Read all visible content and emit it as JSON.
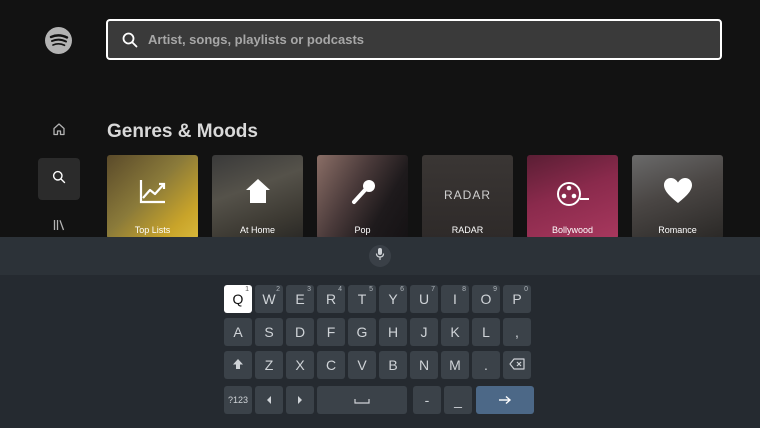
{
  "header": {
    "logo_icon": "spotify-logo",
    "search_placeholder": "Artist, songs, playlists or podcasts"
  },
  "sidebar": {
    "items": [
      {
        "icon": "home-icon"
      },
      {
        "icon": "search-icon",
        "selected": true
      },
      {
        "icon": "library-icon"
      }
    ]
  },
  "section": {
    "title": "Genres & Moods",
    "tiles": [
      {
        "label": "Top Lists",
        "icon": "trending-up-icon"
      },
      {
        "label": "At Home",
        "icon": "house-icon"
      },
      {
        "label": "Pop",
        "icon": "microphone-icon"
      },
      {
        "label": "RADAR",
        "title_text": "RADAR"
      },
      {
        "label": "Bollywood",
        "icon": "film-reel-icon"
      },
      {
        "label": "Romance",
        "icon": "heart-icon"
      }
    ]
  },
  "keyboard": {
    "mic_icon": "microphone-icon",
    "row1": [
      {
        "k": "Q",
        "sup": "1"
      },
      {
        "k": "W",
        "sup": "2"
      },
      {
        "k": "E",
        "sup": "3"
      },
      {
        "k": "R",
        "sup": "4"
      },
      {
        "k": "T",
        "sup": "5"
      },
      {
        "k": "Y",
        "sup": "6"
      },
      {
        "k": "U",
        "sup": "7"
      },
      {
        "k": "I",
        "sup": "8"
      },
      {
        "k": "O",
        "sup": "9"
      },
      {
        "k": "P",
        "sup": "0"
      }
    ],
    "row2": [
      "A",
      "S",
      "D",
      "F",
      "G",
      "H",
      "J",
      "K",
      "L",
      ","
    ],
    "row3": [
      "Z",
      "X",
      "C",
      "V",
      "B",
      "N",
      "M",
      "."
    ],
    "row4": {
      "sym": "?123",
      "dash": "-",
      "underscore": "_"
    },
    "selected_key": "Q"
  }
}
